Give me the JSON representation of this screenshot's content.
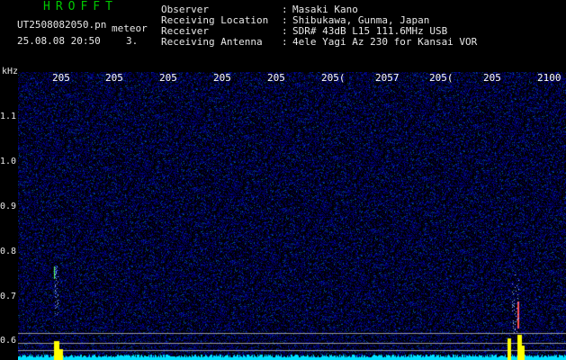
{
  "header": {
    "app_title": "HROFFT",
    "file_name": "UT2508082050.pn",
    "tag": "meteor",
    "timestamp": "25.08.08 20:50",
    "count": "3.",
    "observer_label": "Observer",
    "observer_sep": ":",
    "observer": "Masaki Kano",
    "location_label": "Receiving Location",
    "location_sep": ":",
    "location": "Shibukawa, Gunma, Japan",
    "receiver_label": "Receiver",
    "receiver_sep": ":",
    "receiver": "SDR# 43dB L15 111.6MHz USB",
    "antenna_label": "Receiving Antenna",
    "antenna_sep": ":",
    "antenna": "4ele Yagi Az 230 for Kansai VOR"
  },
  "axis": {
    "y_unit": "kHz",
    "y_ticks": [
      "1.1",
      "1.0",
      "0.9",
      "0.8",
      "0.7",
      "0.6"
    ],
    "x_ticks": [
      "205",
      "205",
      "205",
      "205",
      "205",
      "205(",
      "2057",
      "205(",
      "205",
      "2100"
    ]
  },
  "colors": {
    "background": "#000000",
    "noise": "#1a1a8c",
    "signal": "#ffff00",
    "baseline": "#00e5ff",
    "title": "#00c800"
  }
}
